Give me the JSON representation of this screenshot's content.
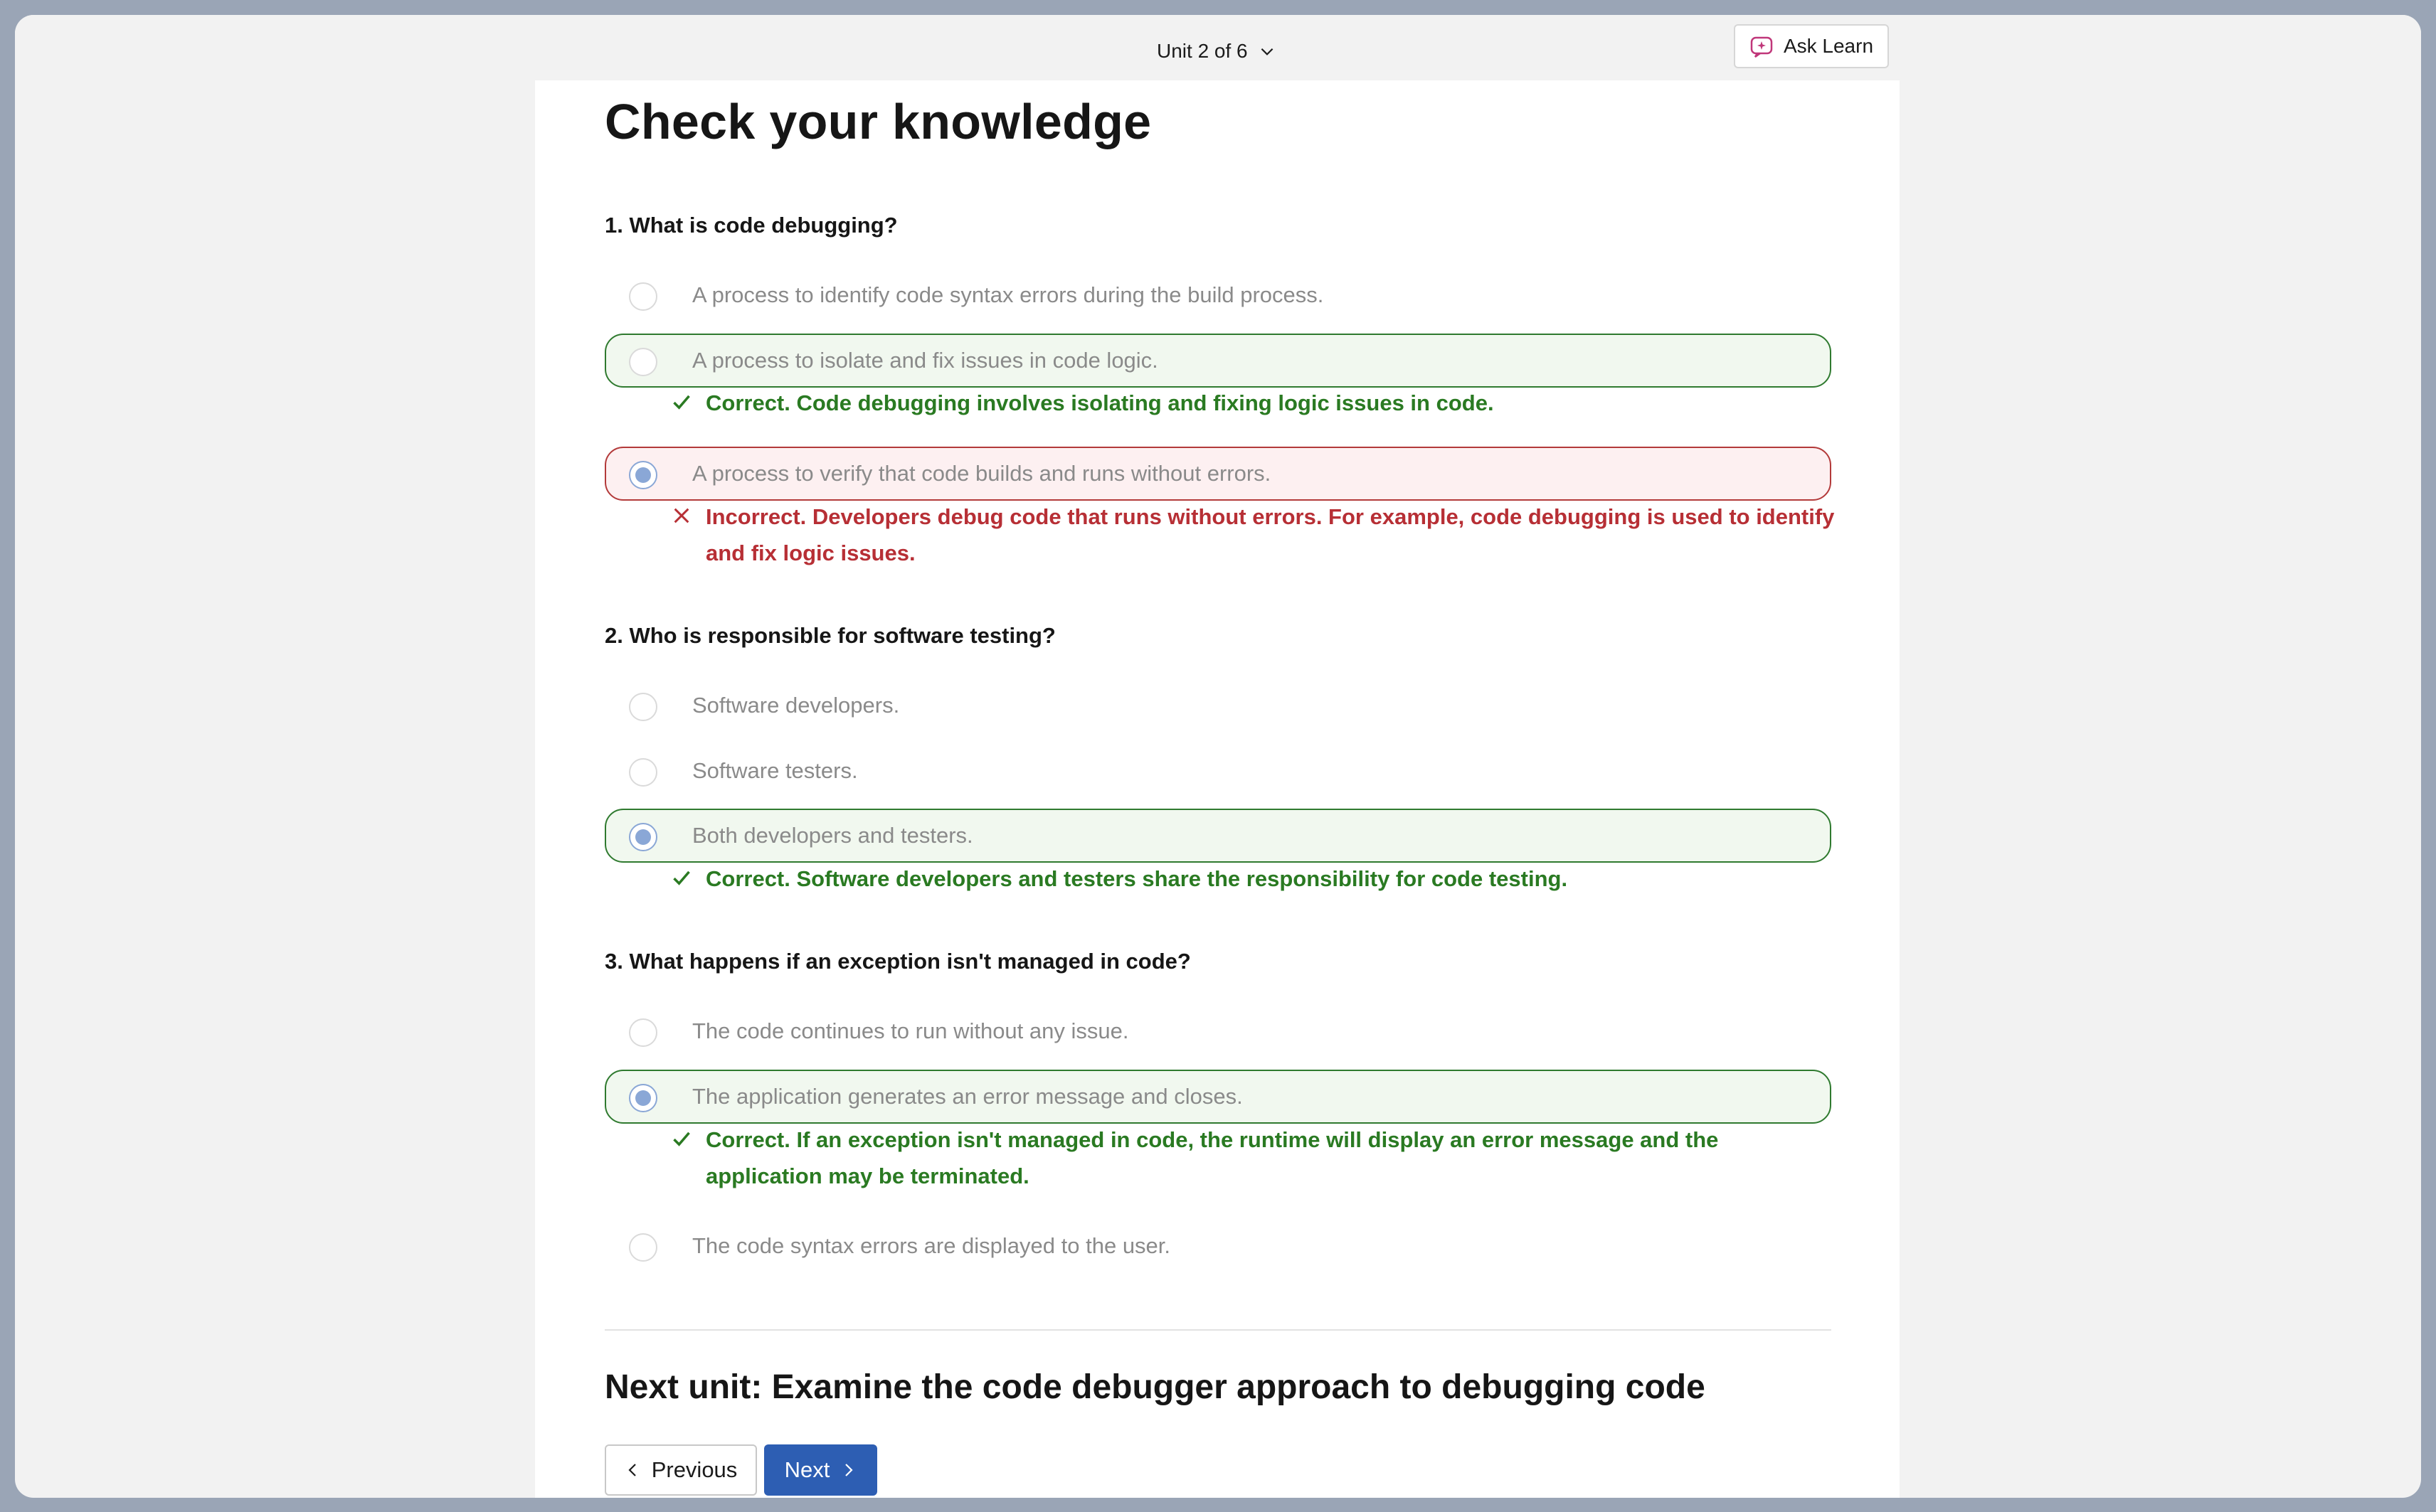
{
  "header": {
    "unit_label": "Unit 2 of 6",
    "ask_learn_label": "Ask Learn"
  },
  "page": {
    "title": "Check your knowledge"
  },
  "questions": [
    {
      "text": "1. What is code debugging?",
      "options": [
        "A process to identify code syntax errors during the build process.",
        "A process to isolate and fix issues in code logic.",
        "A process to verify that code builds and runs without errors."
      ],
      "feedback": [
        "Correct. Code debugging involves isolating and fixing logic issues in code.",
        "Incorrect. Developers debug code that runs without errors. For example, code debugging is used to identify and fix logic issues."
      ]
    },
    {
      "text": "2. Who is responsible for software testing?",
      "options": [
        "Software developers.",
        "Software testers.",
        "Both developers and testers."
      ],
      "feedback": [
        "Correct. Software developers and testers share the responsibility for code testing."
      ]
    },
    {
      "text": "3. What happens if an exception isn't managed in code?",
      "options": [
        "The code continues to run without any issue.",
        "The application generates an error message and closes.",
        "The code syntax errors are displayed to the user."
      ],
      "feedback": [
        "Correct. If an exception isn't managed in code, the runtime will display an error message and the application may be terminated."
      ]
    }
  ],
  "footer": {
    "next_unit": "Next unit: Examine the code debugger approach to debugging code",
    "previous_label": "Previous",
    "next_label": "Next"
  },
  "colors": {
    "correct": "#2a7a22",
    "incorrect": "#b72f35",
    "primary_button": "#2d5eb3",
    "radio_selected": "#8aa7d6"
  },
  "icons": {
    "chevron_down": "chevron-down-icon",
    "ask_learn": "ask-learn-icon",
    "check": "checkmark-icon",
    "cross": "cross-icon",
    "chevron_left": "chevron-left-icon",
    "chevron_right": "chevron-right-icon"
  }
}
